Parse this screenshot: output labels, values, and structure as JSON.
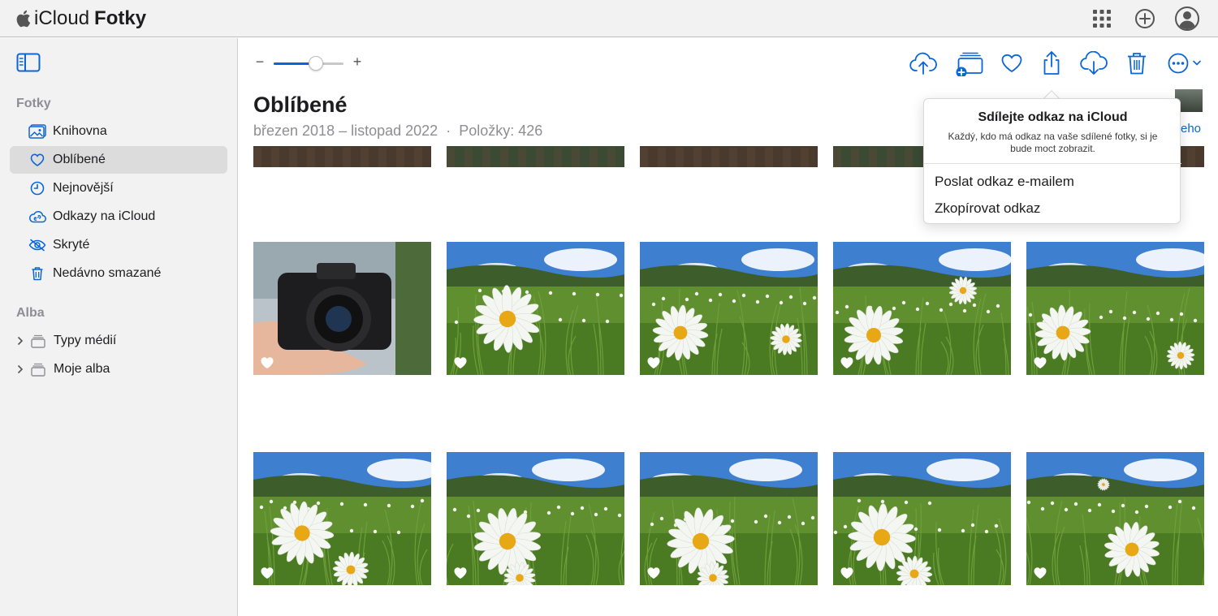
{
  "app": {
    "brand_prefix": "iCloud",
    "brand_app": "Fotky"
  },
  "topbar": {
    "icons": [
      "apps-grid-icon",
      "add-circle-icon",
      "account-icon"
    ]
  },
  "sidebar": {
    "section_photos": "Fotky",
    "items": [
      {
        "label": "Knihovna",
        "icon": "library-icon"
      },
      {
        "label": "Oblíbené",
        "icon": "heart-icon",
        "active": true
      },
      {
        "label": "Nejnovější",
        "icon": "clock-icon"
      },
      {
        "label": "Odkazy na iCloud",
        "icon": "cloud-link-icon"
      },
      {
        "label": "Skryté",
        "icon": "hidden-eye-icon"
      },
      {
        "label": "Nedávno smazané",
        "icon": "trash-icon"
      }
    ],
    "section_albums": "Alba",
    "albums": [
      {
        "label": "Typy médií",
        "icon": "album-stack-icon"
      },
      {
        "label": "Moje alba",
        "icon": "album-stack-icon"
      }
    ]
  },
  "zoom": {
    "minus": "−",
    "plus": "+",
    "level": 0.6
  },
  "toolbar": {
    "icons": [
      "upload-icon",
      "add-to-album-icon",
      "favorite-icon",
      "share-icon",
      "download-icon",
      "delete-icon",
      "more-icon"
    ]
  },
  "main": {
    "title": "Oblíbené",
    "date_range": "březen 2018 – listopad 2022",
    "separator": "·",
    "count": "Položky: 426",
    "corner_link": "eho"
  },
  "share_popover": {
    "title": "Sdílejte odkaz na iCloud",
    "description": "Každý, kdo má odkaz na vaše sdílené fotky, si je bude moct zobrazit.",
    "items": [
      "Poslat odkaz e-mailem",
      "Zkopírovat odkaz"
    ]
  },
  "colors": {
    "accent": "#0a66d6",
    "sidebar_bg": "#f2f2f2",
    "active_bg": "#dcdcdc"
  }
}
